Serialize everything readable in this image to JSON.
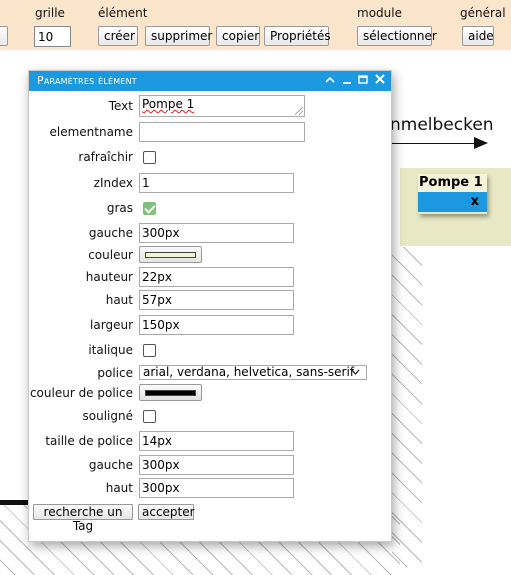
{
  "toolbar": {
    "groups": {
      "grille": "grille",
      "element": "élément",
      "module": "module",
      "general": "général"
    },
    "grid_value": "10",
    "buttons": {
      "creer": "créer",
      "supprimer": "supprimer",
      "copier": "copier",
      "proprietes": "Propriétés",
      "selectionner": "sélectionner",
      "aide": "aide"
    }
  },
  "canvas": {
    "behind_text": "nmelbecken",
    "widget": {
      "title": "Pompe 1",
      "close": "x"
    }
  },
  "dialog": {
    "title": "Paramètres élément",
    "icons": [
      "chevron-up-icon",
      "minimize-icon",
      "maximize-icon",
      "close-icon"
    ],
    "fields": {
      "text": {
        "label": "Text",
        "value": "Pompe 1"
      },
      "elementname": {
        "label": "elementname",
        "value": ""
      },
      "rafraichir": {
        "label": "rafraîchir",
        "checked": false
      },
      "zindex": {
        "label": "zIndex",
        "value": "1"
      },
      "gras": {
        "label": "gras",
        "checked": true
      },
      "gauche": {
        "label": "gauche",
        "value": "300px"
      },
      "couleur": {
        "label": "couleur",
        "color": "#f4f4d8"
      },
      "hauteur": {
        "label": "hauteur",
        "value": "22px"
      },
      "haut": {
        "label": "haut",
        "value": "57px"
      },
      "largeur": {
        "label": "largeur",
        "value": "150px"
      },
      "italique": {
        "label": "italique",
        "checked": false
      },
      "police": {
        "label": "police",
        "value": "arial, verdana, helvetica, sans-serif"
      },
      "couleur_police": {
        "label": "couleur de police",
        "color": "#000000"
      },
      "souligne": {
        "label": "souligné",
        "checked": false
      },
      "taille_police": {
        "label": "taille de police",
        "value": "14px"
      },
      "gauche2": {
        "label": "gauche",
        "value": "300px"
      },
      "haut2": {
        "label": "haut",
        "value": "300px"
      }
    },
    "buttons": {
      "recherche": "recherche un Tag",
      "accepter": "accepter"
    }
  },
  "colors": {
    "toolbar_bg": "#fbe6cc",
    "accent": "#1b98e0",
    "check": "#82c17d"
  }
}
